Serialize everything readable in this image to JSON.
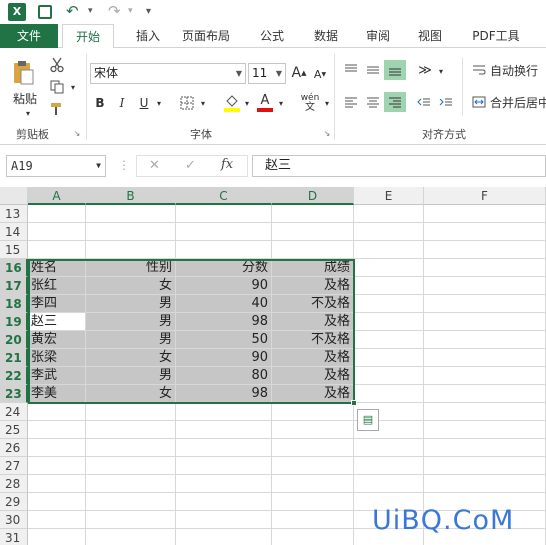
{
  "quick_access": {
    "app_icon": "X",
    "save_icon": "save-icon",
    "undo_icon": "undo-icon",
    "redo_icon": "redo-icon"
  },
  "tabs": [
    "文件",
    "开始",
    "插入",
    "页面布局",
    "公式",
    "数据",
    "审阅",
    "视图",
    "PDF工具"
  ],
  "ribbon": {
    "clipboard": {
      "paste_label": "粘贴",
      "group_label": "剪贴板"
    },
    "font": {
      "font_name": "宋体",
      "font_size": "11",
      "grow": "A",
      "shrink": "A",
      "bold": "B",
      "italic": "I",
      "underline": "U",
      "font_color": "A",
      "phonetic": "wén",
      "group_label": "字体"
    },
    "alignment": {
      "wrap_text": "自动换行",
      "merge_center": "合并后居中",
      "group_label": "对齐方式"
    }
  },
  "formula_bar": {
    "name_box": "A19",
    "cancel_icon": "✕",
    "enter_icon": "✓",
    "fx": "fx",
    "content": "赵三"
  },
  "grid": {
    "columns": [
      "A",
      "B",
      "C",
      "D",
      "E",
      "F"
    ],
    "rows": [
      "13",
      "14",
      "15",
      "16",
      "17",
      "18",
      "19",
      "20",
      "21",
      "22",
      "23",
      "24",
      "25",
      "26",
      "27",
      "28",
      "29",
      "30",
      "31"
    ],
    "table": [
      [
        "姓名",
        "性别",
        "分数",
        "成绩"
      ],
      [
        "张红",
        "女",
        "90",
        "及格"
      ],
      [
        "李四",
        "男",
        "40",
        "不及格"
      ],
      [
        "赵三",
        "男",
        "98",
        "及格"
      ],
      [
        "黄宏",
        "男",
        "50",
        "不及格"
      ],
      [
        "张梁",
        "女",
        "90",
        "及格"
      ],
      [
        "李武",
        "男",
        "80",
        "及格"
      ],
      [
        "李美",
        "女",
        "98",
        "及格"
      ]
    ]
  },
  "colors": {
    "accent": "#217346",
    "selection": "#c6c6c6"
  },
  "watermark": "UiBQ.CoM"
}
